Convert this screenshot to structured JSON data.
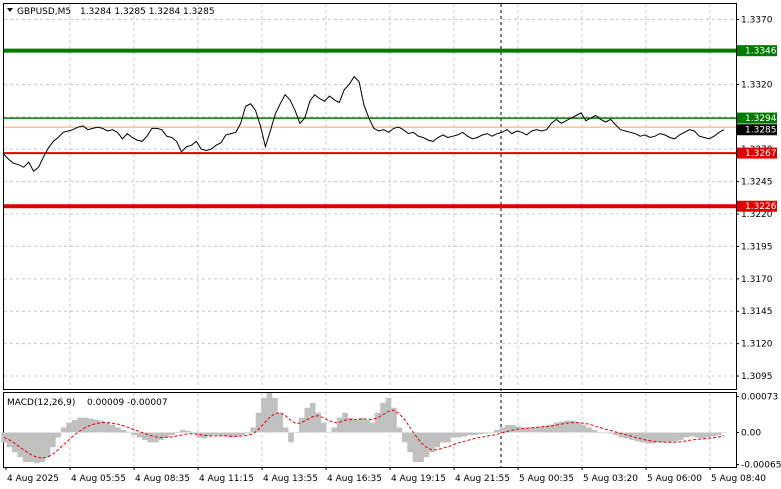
{
  "chart_header": {
    "symbol_label": "GBPUSD,M5",
    "ohlc_text": "1.3284 1.3285 1.3284 1.3285"
  },
  "macd_label": {
    "name": "MACD(12,26,9)",
    "values_text": "0.00009 -0.00007"
  },
  "chart_data": [
    {
      "type": "line",
      "panel": "price",
      "ylim": [
        1.3085,
        1.3382
      ],
      "y_ticks": [
        "1.3370",
        "1.3345",
        "1.3320",
        "1.3295",
        "1.3270",
        "1.3245",
        "1.3220",
        "1.3195",
        "1.3170",
        "1.3145",
        "1.3120",
        "1.3095"
      ],
      "x_ticks": [
        "4 Aug 2025",
        "4 Aug 05:55",
        "4 Aug 08:35",
        "4 Aug 11:15",
        "4 Aug 13:55",
        "4 Aug 16:35",
        "4 Aug 19:15",
        "4 Aug 21:55",
        "5 Aug 00:35",
        "5 Aug 03:20",
        "5 Aug 06:00",
        "5 Aug 08:40"
      ],
      "grid": true,
      "series": [
        {
          "values": [
            1.3266,
            1.3262,
            1.3259,
            1.3258,
            1.3256,
            1.326,
            1.3253,
            1.3256,
            1.3264,
            1.3271,
            1.3276,
            1.3279,
            1.3283,
            1.3284,
            1.3285,
            1.3287,
            1.3288,
            1.3285,
            1.3286,
            1.3287,
            1.3286,
            1.3284,
            1.3285,
            1.3283,
            1.3278,
            1.3282,
            1.3279,
            1.3277,
            1.3276,
            1.328,
            1.3286,
            1.3286,
            1.3285,
            1.328,
            1.3279,
            1.3276,
            1.3268,
            1.3272,
            1.3273,
            1.3276,
            1.327,
            1.3269,
            1.327,
            1.3273,
            1.3275,
            1.3281,
            1.3282,
            1.3283,
            1.329,
            1.3303,
            1.3305,
            1.33,
            1.3288,
            1.3272,
            1.3284,
            1.3297,
            1.3305,
            1.3312,
            1.3308,
            1.33,
            1.329,
            1.3294,
            1.3307,
            1.3312,
            1.3309,
            1.3307,
            1.3311,
            1.3308,
            1.3306,
            1.3316,
            1.332,
            1.3326,
            1.3322,
            1.3304,
            1.3294,
            1.3286,
            1.3284,
            1.3285,
            1.3283,
            1.3286,
            1.3287,
            1.3285,
            1.3282,
            1.3283,
            1.328,
            1.3279,
            1.3277,
            1.3276,
            1.3279,
            1.3281,
            1.3279,
            1.328,
            1.3281,
            1.3283,
            1.328,
            1.3278,
            1.3279,
            1.3281,
            1.3282,
            1.328,
            1.3282,
            1.3283,
            1.3285,
            1.3282,
            1.3284,
            1.3283,
            1.3281,
            1.3284,
            1.3285,
            1.3284,
            1.3285,
            1.329,
            1.3293,
            1.329,
            1.3292,
            1.3294,
            1.3296,
            1.3298,
            1.3292,
            1.3294,
            1.3296,
            1.3293,
            1.3291,
            1.3293,
            1.3289,
            1.3285,
            1.3284,
            1.3283,
            1.3282,
            1.328,
            1.3281,
            1.3279,
            1.328,
            1.3282,
            1.3281,
            1.3279,
            1.3278,
            1.3281,
            1.3283,
            1.3285,
            1.3284,
            1.328,
            1.3279,
            1.3278,
            1.328,
            1.3283,
            1.3285
          ]
        }
      ],
      "levels": [
        {
          "value": 1.3346,
          "label": "1.3346",
          "color": "#007a00"
        },
        {
          "value": 1.3294,
          "label": "1.3294",
          "color": "#007a00"
        },
        {
          "value": 1.3285,
          "label": "1.3285",
          "color": "#000000"
        },
        {
          "value": 1.3267,
          "label": "1.3267",
          "color": "#e00000"
        },
        {
          "value": 1.3226,
          "label": "1.3226",
          "color": "#e00000"
        }
      ],
      "reference_line_color": "#f4a460"
    },
    {
      "type": "bar",
      "panel": "macd",
      "name": "MACD(12,26,9)",
      "ylim": [
        -0.0007,
        0.0008
      ],
      "y_ticks": [
        "0.00073",
        "0.00",
        "-0.00065"
      ],
      "series": [
        {
          "values": [
            -0.0002,
            -0.0003,
            -0.0004,
            -0.0005,
            -0.0006,
            -0.0006,
            -0.00062,
            -0.0006,
            -0.0005,
            -0.0003,
            -0.0001,
            0.0001,
            0.0002,
            0.00025,
            0.0003,
            0.0003,
            0.00028,
            0.00026,
            0.00024,
            0.0002,
            0.00016,
            0.0001,
            5e-05,
            0.0,
            -5e-05,
            -0.0001,
            -0.00015,
            -0.0002,
            -0.0002,
            -0.00015,
            -0.0001,
            -5e-05,
            0.0,
            5e-05,
            3e-05,
            -2e-05,
            -0.0001,
            -0.00012,
            -8e-05,
            -5e-05,
            -6e-05,
            -8e-05,
            -0.0001,
            -8e-05,
            -5e-05,
            -2e-05,
            0.0001,
            0.0004,
            0.0007,
            0.0008,
            0.0007,
            0.0004,
            0.0001,
            -0.0002,
            0.0,
            0.0003,
            0.0005,
            0.0006,
            0.0004,
            0.0002,
            0.0,
            0.0001,
            0.0003,
            0.0004,
            0.0003,
            0.00025,
            0.0003,
            0.00025,
            0.0002,
            0.0004,
            0.0006,
            0.0007,
            0.0005,
            0.0001,
            -0.0002,
            -0.0004,
            -0.0006,
            -0.0006,
            -0.0005,
            -0.0004,
            -0.0003,
            -0.0002,
            -0.0002,
            -0.0001,
            -0.0001,
            -8e-05,
            -5e-05,
            -5e-05,
            -3e-05,
            -2e-05,
            0.0,
            5e-05,
            0.0001,
            0.00015,
            0.00015,
            0.00012,
            0.0001,
            0.0001,
            0.0001,
            0.00012,
            0.00014,
            0.00016,
            0.0002,
            0.00022,
            0.00024,
            0.00024,
            0.0002,
            0.00016,
            0.0001,
            5e-05,
            0.0,
            0.0,
            -2e-05,
            -5e-05,
            -0.0001,
            -0.00012,
            -0.00015,
            -0.00018,
            -0.0002,
            -0.00022,
            -0.00022,
            -0.0002,
            -0.0002,
            -0.0002,
            -0.00018,
            -0.00015,
            -0.0001,
            -8e-05,
            -0.0001,
            -0.00012,
            -0.0001,
            -8e-05,
            -5e-05,
            0.0
          ]
        },
        {
          "name": "signal",
          "values": [
            -0.0001,
            -0.00015,
            -0.00022,
            -0.0003,
            -0.00038,
            -0.00045,
            -0.0005,
            -0.00052,
            -0.0005,
            -0.00044,
            -0.00035,
            -0.00025,
            -0.00015,
            -5e-05,
            3e-05,
            0.0001,
            0.00015,
            0.00018,
            0.0002,
            0.0002,
            0.00019,
            0.00017,
            0.00014,
            0.0001,
            6e-05,
            2e-05,
            -2e-05,
            -6e-05,
            -9e-05,
            -0.0001,
            -0.0001,
            -9e-05,
            -7e-05,
            -5e-05,
            -3e-05,
            -3e-05,
            -4e-05,
            -6e-05,
            -7e-05,
            -7e-05,
            -7e-05,
            -7e-05,
            -8e-05,
            -8e-05,
            -7e-05,
            -6e-05,
            -3e-05,
            6e-05,
            0.00018,
            0.0003,
            0.00038,
            0.0004,
            0.00034,
            0.00024,
            0.00018,
            0.0002,
            0.00026,
            0.00032,
            0.00034,
            0.0003,
            0.00024,
            0.0002,
            0.00021,
            0.00025,
            0.00026,
            0.00026,
            0.00027,
            0.00027,
            0.00026,
            0.0003,
            0.00036,
            0.00043,
            0.00045,
            0.00038,
            0.00026,
            0.0001,
            -6e-05,
            -0.0002,
            -0.0003,
            -0.00035,
            -0.00035,
            -0.00032,
            -0.00029,
            -0.00025,
            -0.00021,
            -0.00018,
            -0.00015,
            -0.00012,
            -0.0001,
            -8e-05,
            -6e-05,
            -4e-05,
            -1e-05,
            2e-05,
            5e-05,
            7e-05,
            8e-05,
            9e-05,
            0.0001,
            0.00011,
            0.00012,
            0.00013,
            0.00015,
            0.00017,
            0.00019,
            0.0002,
            0.0002,
            0.00019,
            0.00017,
            0.00014,
            0.0001,
            7e-05,
            4e-05,
            1e-05,
            -2e-05,
            -5e-05,
            -8e-05,
            -0.00011,
            -0.00014,
            -0.00016,
            -0.00018,
            -0.00019,
            -0.0002,
            -0.0002,
            -0.0002,
            -0.00019,
            -0.00017,
            -0.00015,
            -0.00014,
            -0.00013,
            -0.00012,
            -0.00011,
            -9e-05,
            -7e-05
          ]
        }
      ],
      "signal_color": "#e00000",
      "histogram_color": "#c0c0c0"
    }
  ]
}
